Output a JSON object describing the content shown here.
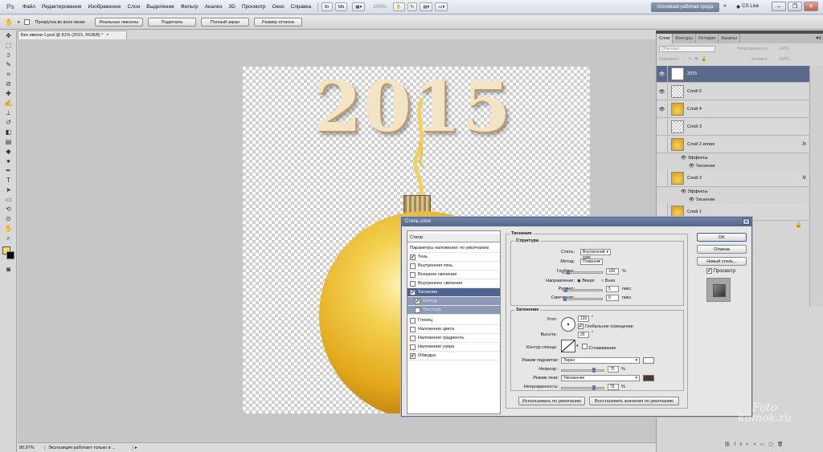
{
  "app": {
    "logo": "Ps",
    "workspace": "Основная рабочая среда",
    "cslive": "CS Live"
  },
  "menu": [
    "Файл",
    "Редактирование",
    "Изображение",
    "Слои",
    "Выделение",
    "Фильтр",
    "Анализ",
    "3D",
    "Просмотр",
    "Окно",
    "Справка"
  ],
  "zoom_menu": "100%",
  "options": {
    "scroll_all": "Прокрутка во всех окнах",
    "buttons": [
      "Реальные пикселы",
      "Подогнать",
      "Полный экран",
      "Размер оттиска"
    ]
  },
  "doc": {
    "tab": "Без имени-1.psd @ 81% (2015, RGB/8) *",
    "artwork_text": "2015"
  },
  "status": {
    "zoom": "80,97%",
    "text": "Экспозиция работает только в ..."
  },
  "layers_panel": {
    "tabs": [
      "Слои",
      "Контуры",
      "История",
      "Каналы"
    ],
    "blend": "Обычные",
    "opacity_label": "Непрозрачность:",
    "opacity": "100%",
    "lock_label": "Закрепить:",
    "fill_label": "Заливка:",
    "fill": "100%",
    "layers": [
      {
        "name": "2015",
        "thumb": "T",
        "fx": ""
      },
      {
        "name": "Слой 5",
        "thumb": "",
        "fx": ""
      },
      {
        "name": "Слой 4",
        "thumb": "",
        "fx": ""
      },
      {
        "name": "Слой 3",
        "thumb": "",
        "fx": ""
      },
      {
        "name": "Слой 2 копия",
        "thumb": "",
        "fx": "fx"
      },
      {
        "name": "Слой 2",
        "thumb": "",
        "fx": "fx"
      },
      {
        "name": "Слой 1",
        "thumb": "",
        "fx": ""
      }
    ],
    "effects_label": "Эффекты",
    "emboss_label": "Тиснение",
    "fx_label": "fx"
  },
  "dialog": {
    "title": "Стиль слоя",
    "styles": [
      "Стили",
      "Параметры наложения: по умолчанию",
      "Тень",
      "Внутренняя тень",
      "Внешнее свечение",
      "Внутреннее свечение",
      "Тиснение",
      "Контур",
      "Текстура",
      "Глянец",
      "Наложение цвета",
      "Наложение градиента",
      "Наложение узора",
      "Обводка"
    ],
    "section": "Тиснение",
    "structure": "Структура",
    "style_label": "Стиль:",
    "style_value": "Внутренний скос",
    "method_label": "Метод:",
    "method_value": "Плавное",
    "depth_label": "Глубина:",
    "depth_value": "100",
    "depth_unit": "%",
    "direction_label": "Направление:",
    "dir_up": "Вверх",
    "dir_down": "Вниз",
    "size_label": "Размер:",
    "size_value": "5",
    "size_unit": "пикс.",
    "soften_label": "Смягчение:",
    "soften_value": "0",
    "soften_unit": "пикс.",
    "shading": "Затенение",
    "angle_label": "Угол:",
    "angle_value": "120",
    "angle_unit": "°",
    "global_light": "Глобальное освещение",
    "altitude_label": "Высота:",
    "altitude_value": "30",
    "altitude_unit": "°",
    "gloss_label": "Контур глянца:",
    "antialias": "Сглаживание",
    "highlight_label": "Режим подсветки:",
    "highlight_value": "Экран",
    "opacity1_label": "Непрозр.:",
    "opacity1_value": "75",
    "opacity1_unit": "%",
    "shadow_label": "Режим тени:",
    "shadow_value": "Умножение",
    "opacity2_label": "Непрозрачность:",
    "opacity2_value": "75",
    "opacity2_unit": "%",
    "btn_default": "Использовать по умолчанию",
    "btn_restore": "Восстановить значения по умолчанию",
    "ok": "OK",
    "cancel": "Отмена",
    "new_style": "Новый стиль...",
    "preview": "Просмотр",
    "highlight_color": "#ffffff",
    "shadow_color": "#4a3a30"
  },
  "watermark": {
    "line1": "Foto",
    "line2": "komok.ru"
  }
}
